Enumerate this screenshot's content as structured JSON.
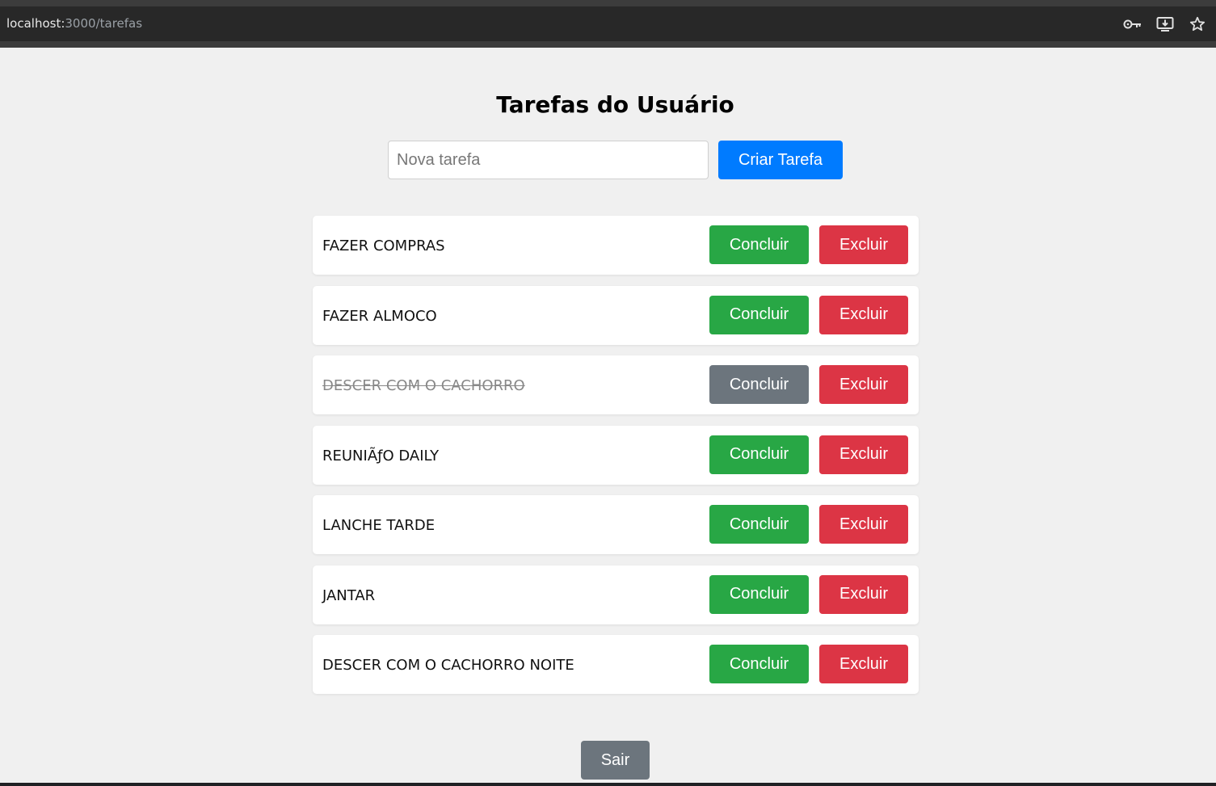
{
  "browser": {
    "url_host": "localhost:",
    "url_path": "3000/tarefas",
    "icons": [
      "key-icon",
      "install-app-icon",
      "star-icon"
    ]
  },
  "page": {
    "title": "Tarefas do Usuário",
    "new_task": {
      "placeholder": "Nova tarefa",
      "value": "",
      "button_label": "Criar Tarefa"
    },
    "tasks": [
      {
        "label": "FAZER COMPRAS",
        "done": false,
        "conclude_label": "Concluir",
        "delete_label": "Excluir"
      },
      {
        "label": "FAZER ALMOCO",
        "done": false,
        "conclude_label": "Concluir",
        "delete_label": "Excluir"
      },
      {
        "label": "DESCER COM O CACHORRO",
        "done": true,
        "conclude_label": "Concluir",
        "delete_label": "Excluir"
      },
      {
        "label": "REUNIÃƒO DAILY",
        "done": false,
        "conclude_label": "Concluir",
        "delete_label": "Excluir"
      },
      {
        "label": "LANCHE TARDE",
        "done": false,
        "conclude_label": "Concluir",
        "delete_label": "Excluir"
      },
      {
        "label": "JANTAR",
        "done": false,
        "conclude_label": "Concluir",
        "delete_label": "Excluir"
      },
      {
        "label": "DESCER COM O CACHORRO NOITE",
        "done": false,
        "conclude_label": "Concluir",
        "delete_label": "Excluir"
      }
    ],
    "logout_label": "Sair"
  },
  "colors": {
    "primary": "#007bff",
    "success": "#28a745",
    "danger": "#dc3545",
    "secondary": "#6c757d",
    "background": "#f0f0f0"
  }
}
